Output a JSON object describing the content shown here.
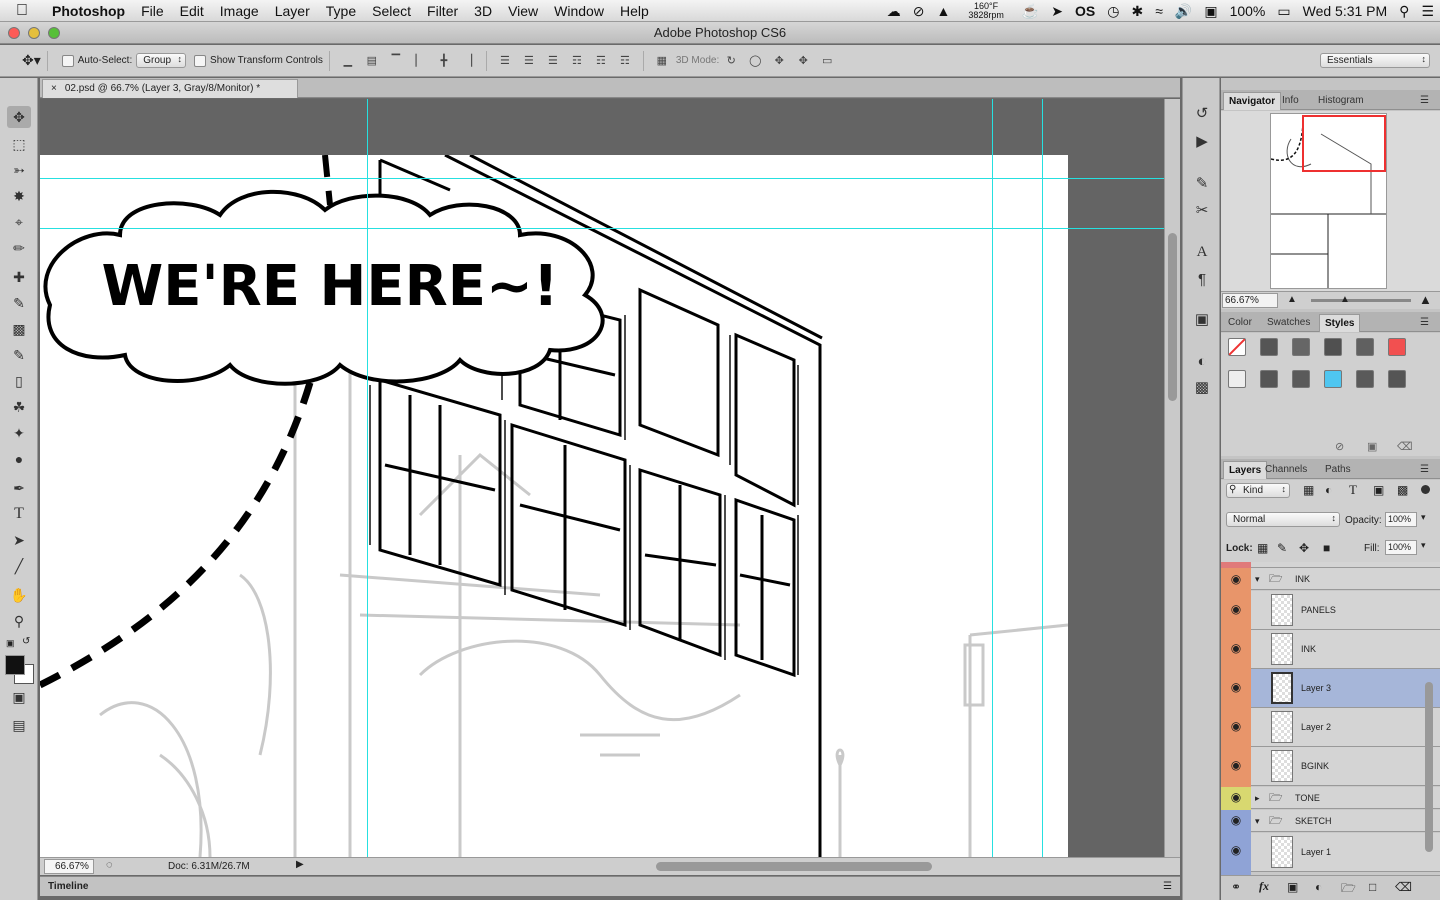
{
  "menubar": {
    "app_name": "Photoshop",
    "items": [
      "File",
      "Edit",
      "Image",
      "Layer",
      "Type",
      "Select",
      "Filter",
      "3D",
      "View",
      "Window",
      "Help"
    ],
    "temp_line1": "160°F",
    "temp_line2": "3828rpm",
    "os_label": "OS",
    "battery": "100%",
    "clock": "Wed 5:31 PM"
  },
  "window": {
    "title": "Adobe Photoshop CS6"
  },
  "options": {
    "auto_select_label": "Auto-Select:",
    "auto_select_value": "Group",
    "transform_label": "Show Transform Controls",
    "mode3d_label": "3D Mode:",
    "workspace": "Essentials"
  },
  "document": {
    "tab_title": "02.psd @ 66.7% (Layer 3, Gray/8/Monitor) *",
    "balloon_text": "WE'RE HERE~!",
    "zoom": "66.67%",
    "doc_size": "Doc: 6.31M/26.7M"
  },
  "timeline": {
    "label": "Timeline"
  },
  "navigator": {
    "tabs": [
      "Navigator",
      "Info",
      "Histogram"
    ],
    "zoom": "66.67%"
  },
  "color_panel": {
    "tabs": [
      "Color",
      "Swatches",
      "Styles"
    ],
    "style_colors": [
      "none",
      "#555555",
      "#666666",
      "#505050",
      "#606060",
      "#f25050",
      "#eeeeee",
      "#555555",
      "#5a5a5a",
      "#4fc6f0",
      "#5a5a5a",
      "#555555"
    ]
  },
  "layers_panel": {
    "tabs": [
      "Layers",
      "Channels",
      "Paths"
    ],
    "kind": "Kind",
    "blend_mode": "Normal",
    "opacity_label": "Opacity:",
    "opacity": "100%",
    "lock_label": "Lock:",
    "fill_label": "Fill:",
    "fill": "100%",
    "groups": {
      "ink": "INK",
      "tone": "TONE",
      "sketch": "SKETCH"
    },
    "ink_layers": [
      "PANELS",
      "INK",
      "Layer 3",
      "Layer 2",
      "BGINK"
    ],
    "sketch_layers": [
      "Layer 1"
    ],
    "selected_layer": "Layer 3",
    "label_colors": {
      "ink": "#e8956a",
      "tone": "#d8d870",
      "sketch": "#8fa3d6",
      "top": "#e07a7a"
    }
  }
}
